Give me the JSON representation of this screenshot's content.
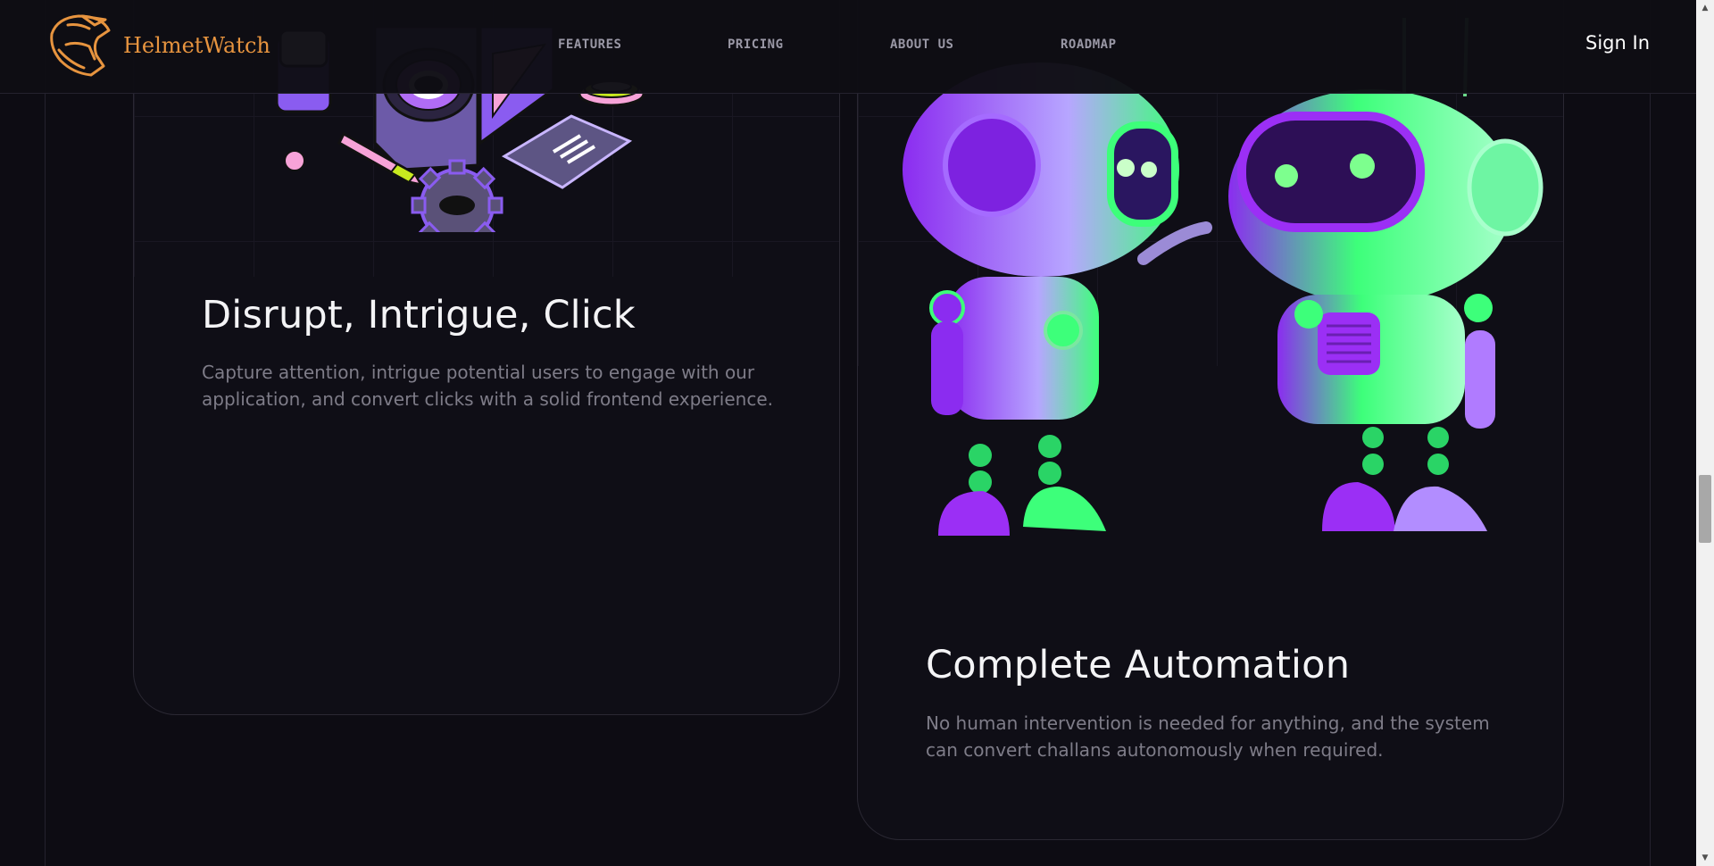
{
  "header": {
    "brand": "HelmetWatch",
    "nav": [
      {
        "label": "FEATURES"
      },
      {
        "label": "PRICING"
      },
      {
        "label": "ABOUT US"
      },
      {
        "label": "ROADMAP"
      }
    ],
    "signin_label": "Sign In"
  },
  "cards": [
    {
      "title": "Disrupt, Intrigue, Click",
      "description": "Capture attention, intrigue potential users to engage with our application, and convert clicks with a solid frontend experience."
    },
    {
      "title": "Complete Automation",
      "description": "No human intervention is needed for anything, and the system can convert challans autonomously when required."
    }
  ],
  "colors": {
    "background": "#0d0c13",
    "brand": "#e7943f",
    "purple": "#8b2cf0",
    "green": "#3dff7a",
    "pink": "#f7a3d8",
    "lime": "#c8ea1f"
  },
  "icons": {
    "logo": "helmet-logo-icon",
    "scroll_up": "scroll-up-arrow-icon",
    "scroll_down": "scroll-down-arrow-icon"
  }
}
